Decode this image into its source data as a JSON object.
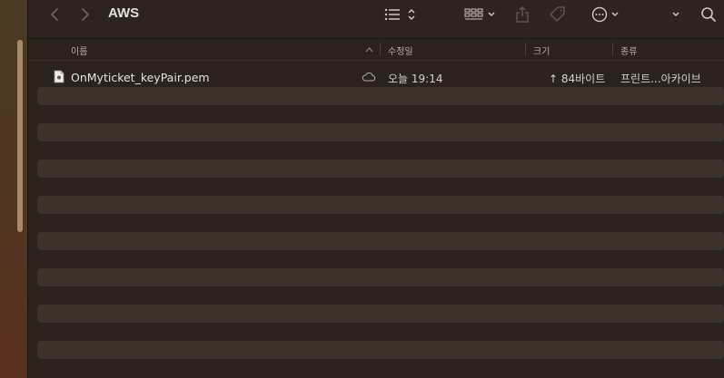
{
  "window": {
    "title": "AWS",
    "icons": {
      "back": "chevron-left-icon",
      "forward": "chevron-right-icon",
      "list_view": "list-icon",
      "sort": "up-down-chevron-icon",
      "group": "grid-icon",
      "share": "share-icon",
      "tag": "tag-icon",
      "more": "ellipsis-circle-icon",
      "expand": "chevron-down-icon",
      "search": "search-icon"
    }
  },
  "columns": {
    "name": "이름",
    "date": "수정일",
    "size": "크기",
    "kind": "종류"
  },
  "files": [
    {
      "name": "OnMyticket_keyPair.pem",
      "date": "오늘 19:14",
      "size": "↑ 84바이트",
      "kind": "프린트...아카이브",
      "icon": "document-icon",
      "status_icon": "icloud-icon"
    }
  ],
  "colors": {
    "background": "#2b221d",
    "stripe": "#3c322c",
    "text": "#e8e2dc"
  }
}
